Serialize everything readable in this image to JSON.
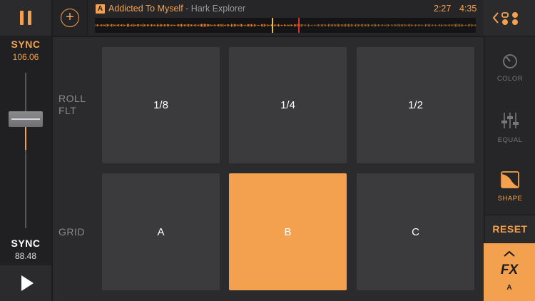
{
  "transport": {
    "pause_icon": "pause-icon",
    "play_icon": "play-icon",
    "sync_top_label": "SYNC",
    "sync_top_bpm": "106.06",
    "sync_bottom_label": "SYNC",
    "sync_bottom_bpm": "88.48"
  },
  "track": {
    "deck": "A",
    "title": "Addicted To Myself",
    "separator": " - ",
    "artist": "Hark Explorer",
    "time_elapsed": "2:27",
    "time_total": "4:35"
  },
  "right_panel": {
    "color_label": "COLOR",
    "equal_label": "EQUAL",
    "shape_label": "SHAPE",
    "reset_label": "RESET",
    "fx_label": "FX",
    "fx_deck": "A"
  },
  "pads": {
    "rows": [
      {
        "label_line1": "ROLL",
        "label_line2": "FLT",
        "pads": [
          "1/8",
          "1/4",
          "1/2"
        ]
      },
      {
        "label_line1": "GRID",
        "label_line2": "",
        "pads": [
          "A",
          "B",
          "C"
        ]
      }
    ],
    "active_pad": "B"
  },
  "colors": {
    "accent": "#f4a14f",
    "background": "#1c1c1e",
    "pad": "#3b3b3e"
  }
}
